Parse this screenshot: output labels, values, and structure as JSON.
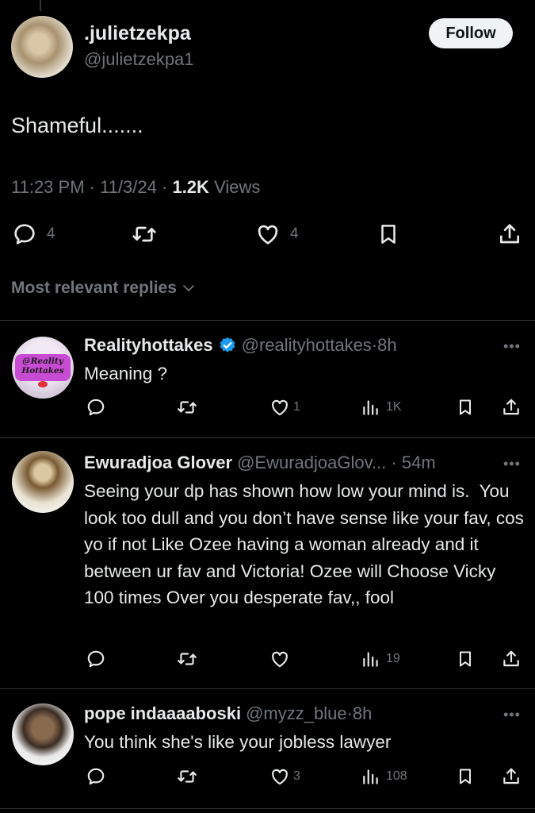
{
  "main": {
    "display_name": ".julietzekpa",
    "handle": "@julietzekpa1",
    "follow_label": "Follow",
    "text": "Shameful.......",
    "time": "11:23 PM",
    "date": "11/3/24",
    "views_count": "1.2K",
    "views_label": "Views",
    "replies": "4",
    "likes": "4"
  },
  "sort": {
    "label": "Most relevant replies"
  },
  "replies": [
    {
      "name": "Realityhottakes",
      "handle": "@realityhottakes",
      "time": "8h",
      "verified": true,
      "text": "Meaning ?",
      "replies": "",
      "likes": "1",
      "views": "1K",
      "avatar_text": "@Reality Hottakes"
    },
    {
      "name": "Ewuradjoa Glover",
      "handle": "@EwuradjoaGlov...",
      "time": "54m",
      "verified": false,
      "text": "Seeing your dp has shown how low your mind is.  You look too dull and you don’t have sense like your fav, cos yo if not Like Ozee having a woman already and it between ur fav and Victoria! Ozee will Choose Vicky 100 times Over you desperate fav,, fool",
      "replies": "",
      "likes": "",
      "views": "19"
    },
    {
      "name": "pope indaaaaboski",
      "handle": "@myzz_blue",
      "time": "8h",
      "verified": false,
      "text": "You think she's like your jobless lawyer",
      "replies": "",
      "likes": "3",
      "views": "108"
    }
  ],
  "colors": {
    "background": "#000000",
    "text": "#e7e9ea",
    "muted": "#71767b",
    "divider": "#2f3336",
    "verified": "#1d9bf0"
  },
  "icons": [
    "reply-icon",
    "repost-icon",
    "like-icon",
    "bookmark-icon",
    "share-icon",
    "views-icon",
    "more-icon",
    "verified-icon",
    "chevron-down-icon"
  ]
}
